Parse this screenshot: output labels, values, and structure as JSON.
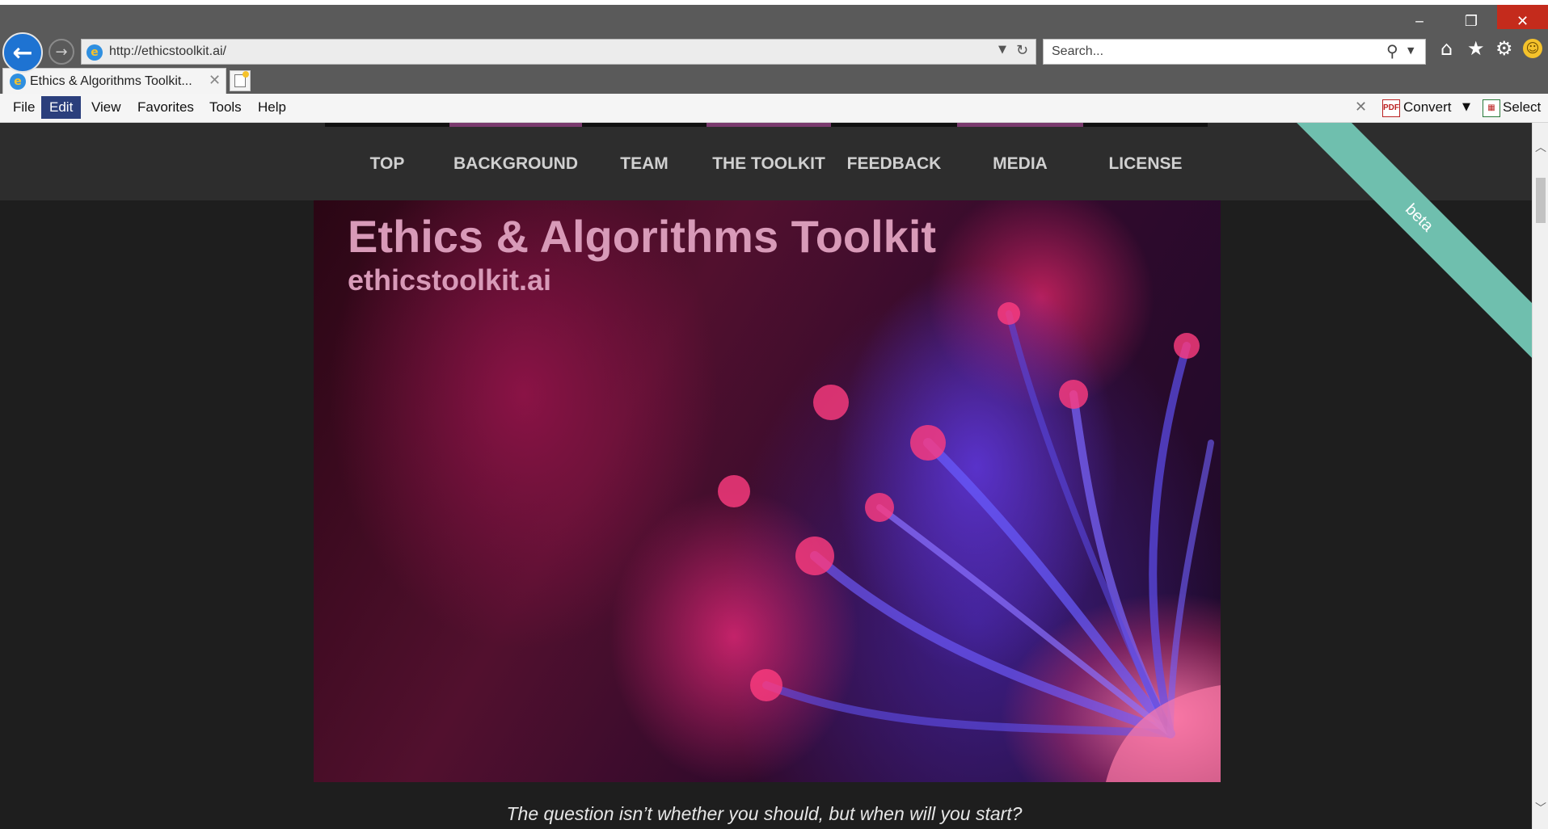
{
  "browser": {
    "url": "http://ethicstoolkit.ai/",
    "search_placeholder": "Search...",
    "tab_title": "Ethics & Algorithms Toolkit...",
    "window_controls": {
      "minimize": "‒",
      "maximize": "❐",
      "close": "✕"
    }
  },
  "menubar": {
    "items": [
      "File",
      "Edit",
      "View",
      "Favorites",
      "Tools",
      "Help"
    ],
    "active_item": "Edit",
    "convert_label": "Convert",
    "select_label": "Select"
  },
  "site": {
    "nav": [
      "TOP",
      "BACKGROUND",
      "TEAM",
      "THE TOOLKIT",
      "FEEDBACK",
      "MEDIA",
      "LICENSE"
    ],
    "ribbon": "beta",
    "hero_title": "Ethics & Algorithms Toolkit",
    "hero_subtitle": "ethicstoolkit.ai",
    "tagline": "The question isn’t whether you should, but when will you start?"
  },
  "colors": {
    "ribbon": "#6fbfae",
    "nav_accent": "#7a3a6e",
    "hero_text": "#d89ab8",
    "close_button": "#c42b1c",
    "active_menu": "#2b3f7c"
  },
  "icons": {
    "back": "arrow-left-icon",
    "forward": "arrow-right-icon",
    "home": "home-icon",
    "favorites": "star-icon",
    "settings": "gear-icon",
    "feedback": "smiley-icon"
  }
}
